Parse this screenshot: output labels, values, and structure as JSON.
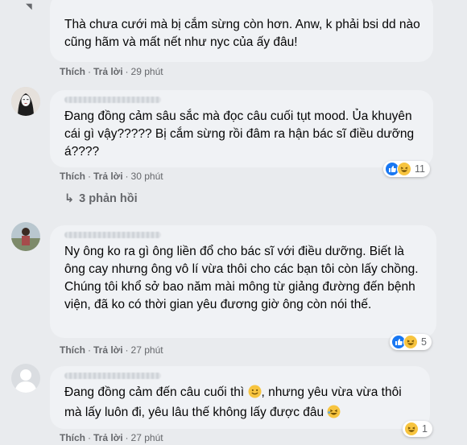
{
  "comments": [
    {
      "text": "Thà chưa cưới mà bị cắm sừng còn hơn. Anw, k phải bsi dd nào cũng hãm và mất nết như nyc của ấy đâu!",
      "like": "Thích",
      "reply": "Trả lời",
      "time": "29 phút"
    },
    {
      "text": "Đang đồng cảm sâu sắc mà đọc câu cuối tụt mood. Ủa khuyên cái gì vậy????? Bị cắm sừng rồi đâm ra hận bác sĩ điều dưỡng á????",
      "like": "Thích",
      "reply": "Trả lời",
      "time": "30 phút",
      "reactions": "11",
      "replies": "3 phản hồi"
    },
    {
      "text": "Ny ông ko ra gì ông liền đổ cho bác sĩ với điều dưỡng. Biết là ông cay nhưng ông vô lí vừa thôi cho các bạn tôi còn lấy chồng. Chúng tôi khổ sở bao năm mài mông từ giảng đường đến bệnh viện, đã ko có thời gian yêu đương giờ ông còn nói thế.",
      "like": "Thích",
      "reply": "Trả lời",
      "time": "27 phút",
      "reactions": "5"
    },
    {
      "text_a": "Đang đồng cảm đến câu cuối thì",
      "text_b": ", nhưng yêu vừa vừa thôi mà lấy luôn đi, yêu lâu thế không lấy được đâu",
      "like": "Thích",
      "reply": "Trả lời",
      "time": "27 phút",
      "reactions": "1"
    }
  ],
  "colors": {
    "like": "#1877f2",
    "haha": "#f7c43f",
    "bubble": "#f0f2f5",
    "meta": "#65676b"
  }
}
